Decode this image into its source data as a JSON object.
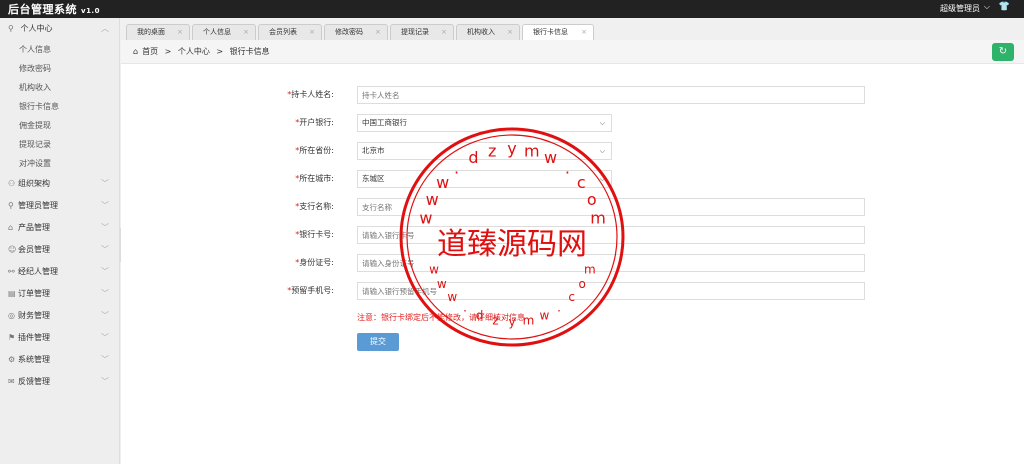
{
  "header": {
    "brand": "后台管理系统",
    "version": "v1.0",
    "user": "超级管理员"
  },
  "sidebar": {
    "groups": [
      {
        "label": "个人中心",
        "icon": "user-icon",
        "expanded": true,
        "items": [
          "个人信息",
          "修改密码",
          "机构收入",
          "银行卡信息",
          "佣金提现",
          "提现记录",
          "对冲设置"
        ]
      },
      {
        "label": "组织架构",
        "icon": "org-icon"
      },
      {
        "label": "管理员管理",
        "icon": "admin-icon"
      },
      {
        "label": "产品管理",
        "icon": "product-icon"
      },
      {
        "label": "会员管理",
        "icon": "member-icon"
      },
      {
        "label": "经纪人管理",
        "icon": "broker-icon"
      },
      {
        "label": "订单管理",
        "icon": "order-icon"
      },
      {
        "label": "财务管理",
        "icon": "finance-icon"
      },
      {
        "label": "插件管理",
        "icon": "plugin-icon"
      },
      {
        "label": "系统管理",
        "icon": "system-icon"
      },
      {
        "label": "反馈管理",
        "icon": "feedback-icon"
      }
    ]
  },
  "tabs": [
    {
      "label": "我的桌面",
      "active": false
    },
    {
      "label": "个人信息",
      "active": false
    },
    {
      "label": "会员列表",
      "active": false
    },
    {
      "label": "修改密码",
      "active": false
    },
    {
      "label": "提现记录",
      "active": false
    },
    {
      "label": "机构收入",
      "active": false
    },
    {
      "label": "银行卡信息",
      "active": true
    }
  ],
  "breadcrumb": [
    "首页",
    ">",
    "个人中心",
    ">",
    "银行卡信息"
  ],
  "form": {
    "fields": [
      {
        "label": "持卡人姓名:",
        "type": "input",
        "value": "",
        "placeholder": "持卡人姓名"
      },
      {
        "label": "开户银行:",
        "type": "select",
        "value": "中国工商银行"
      },
      {
        "label": "所在省份:",
        "type": "select",
        "value": "北京市"
      },
      {
        "label": "所在城市:",
        "type": "select",
        "value": "东城区"
      },
      {
        "label": "支行名称:",
        "type": "input",
        "value": "",
        "placeholder": "支行名称"
      },
      {
        "label": "银行卡号:",
        "type": "input",
        "value": "",
        "placeholder": "请输入银行卡号"
      },
      {
        "label": "身份证号:",
        "type": "input",
        "value": "",
        "placeholder": "请输入身份证号"
      },
      {
        "label": "预留手机号:",
        "type": "input",
        "value": "",
        "placeholder": "请输入银行预留手机号"
      }
    ],
    "notice": "注意：银行卡绑定后不能修改，请仔细核对信息",
    "submit": "提交"
  },
  "watermark": {
    "text": "道臻源码网",
    "url_chars": [
      "w",
      "w",
      "w",
      ".",
      "d",
      "z",
      "y",
      "m",
      "w",
      ".",
      "c",
      "o",
      "m"
    ],
    "color": "#e01010"
  },
  "colors": {
    "topbar": "#222222",
    "accent": "#5b9bd5",
    "refresh": "#2db36a",
    "required": "#e02020"
  }
}
